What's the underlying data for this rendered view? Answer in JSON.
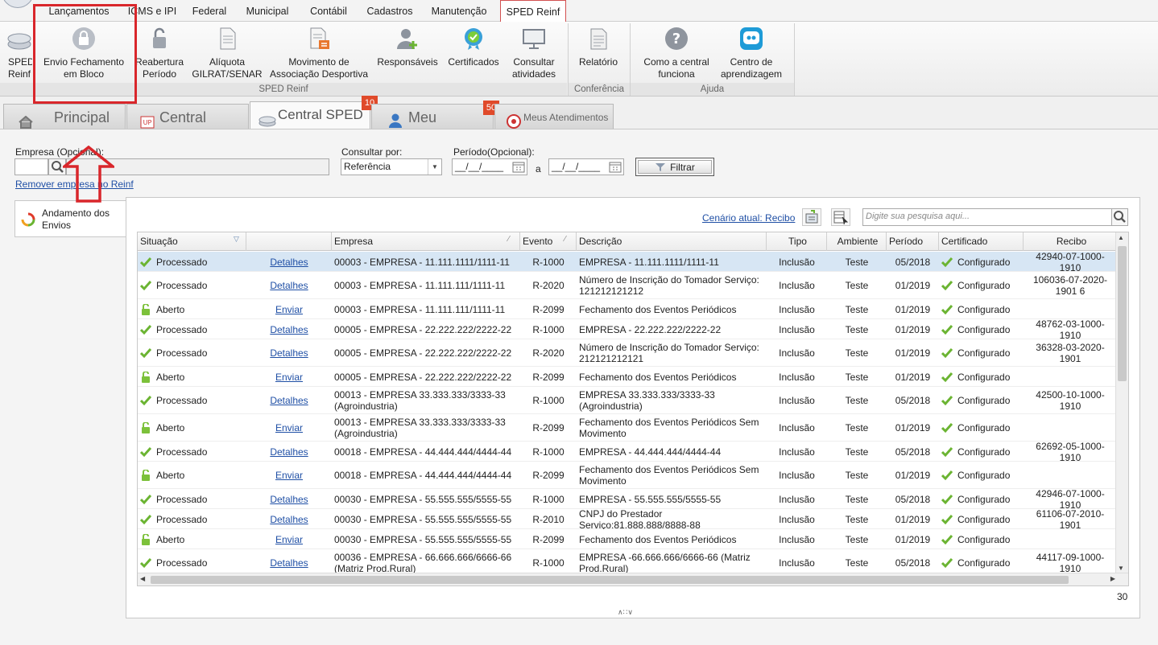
{
  "menu": {
    "tabs": [
      {
        "label": "Lançamentos"
      },
      {
        "label": "ICMS e IPI"
      },
      {
        "label": "Federal"
      },
      {
        "label": "Municipal"
      },
      {
        "label": "Contábil"
      },
      {
        "label": "Cadastros"
      },
      {
        "label": "Manutenção"
      },
      {
        "label": "SPED Reinf",
        "active": true
      }
    ]
  },
  "ribbon": {
    "buttons": [
      {
        "label": "SPED Reinf",
        "icon": "sped-icon"
      },
      {
        "label": "Envio Fechamento em Bloco",
        "icon": "lock-icon"
      },
      {
        "label": "Reabertura Período",
        "icon": "unlock-icon"
      },
      {
        "label": "Alíquota GILRAT/SENAR",
        "icon": "document-icon"
      },
      {
        "label": "Movimento de Associação Desportiva",
        "icon": "document-arrows-icon"
      },
      {
        "label": "Responsáveis",
        "icon": "user-add-icon"
      },
      {
        "label": "Certificados",
        "icon": "certificate-icon"
      },
      {
        "label": "Consultar atividades",
        "icon": "monitor-icon"
      },
      {
        "label": "Relatório",
        "icon": "report-icon"
      },
      {
        "label": "Como a central funciona",
        "icon": "help-icon"
      },
      {
        "label": "Centro de aprendizagem",
        "icon": "learning-icon"
      }
    ],
    "groups": [
      "SPED Reinf",
      "Conferência",
      "Ajuda"
    ]
  },
  "tabs": [
    {
      "label": "Principal",
      "icon": "home-icon"
    },
    {
      "label": "Central PackUp",
      "icon": "packup-icon"
    },
    {
      "label": "Central SPED Reinf",
      "icon": "sped-icon",
      "badge": "10",
      "active": true
    },
    {
      "label": "Meu Gerente",
      "icon": "user-icon",
      "badge": "50"
    },
    {
      "label": "Meus Atendimentos",
      "icon": "support-icon"
    }
  ],
  "filters": {
    "empresa_label": "Empresa (Opcional):",
    "empresa_value": "",
    "remover_link": "Remover empresa no Reinf",
    "consultar_label": "Consultar por:",
    "consultar_value": "Referência",
    "periodo_label": "Período(Opcional):",
    "periodo_from": "__/__/____",
    "periodo_sep": "a",
    "periodo_to": "__/__/____",
    "filtrar_label": "Filtrar"
  },
  "sidebar": {
    "item_label": "Andamento dos Envios"
  },
  "toolbar": {
    "cenario_link": "Cenário atual: Recibo",
    "search_placeholder": "Digite sua pesquisa aqui..."
  },
  "grid": {
    "headers": [
      "Situação",
      "",
      "Empresa",
      "Evento",
      "Descrição",
      "Tipo",
      "Ambiente",
      "Período",
      "Certificado",
      "Recibo"
    ],
    "rows": [
      {
        "situacao": "Processado",
        "status": "ok",
        "acao": "Detalhes",
        "empresa": "00003 - EMPRESA - 11.111.1111/1111-11",
        "evento": "R-1000",
        "descricao": "EMPRESA - 11.111.1111/1111-11",
        "tipo": "Inclusão",
        "ambiente": "Teste",
        "periodo": "05/2018",
        "certificado": "Configurado",
        "recibo": "42940-07-1000-1910",
        "h": 25,
        "selected": true
      },
      {
        "situacao": "Processado",
        "status": "ok",
        "acao": "Detalhes",
        "empresa": "00003 - EMPRESA - 11.111.111/1111-11",
        "evento": "R-2020",
        "descricao": "Número de Inscrição do Tomador Serviço: 121212121212",
        "tipo": "Inclusão",
        "ambiente": "Teste",
        "periodo": "01/2019",
        "certificado": "Configurado",
        "recibo": "106036-07-2020-1901 6",
        "h": 34
      },
      {
        "situacao": "Aberto",
        "status": "open",
        "acao": "Enviar",
        "empresa": "00003 - EMPRESA -  11.111.111/1111-11",
        "evento": "R-2099",
        "descricao": "Fechamento dos Eventos Periódicos",
        "tipo": "Inclusão",
        "ambiente": "Teste",
        "periodo": "01/2019",
        "certificado": "Configurado",
        "recibo": "",
        "h": 25
      },
      {
        "situacao": "Processado",
        "status": "ok",
        "acao": "Detalhes",
        "empresa": "00005 - EMPRESA -  22.222.222/2222-22",
        "evento": "R-1000",
        "descricao": "EMPRESA -  22.222.222/2222-22",
        "tipo": "Inclusão",
        "ambiente": "Teste",
        "periodo": "01/2019",
        "certificado": "Configurado",
        "recibo": "48762-03-1000-1910",
        "h": 25
      },
      {
        "situacao": "Processado",
        "status": "ok",
        "acao": "Detalhes",
        "empresa": "00005 - EMPRESA -  22.222.222/2222-22",
        "evento": "R-2020",
        "descricao": "Número de Inscrição do Tomador Serviço: 212121212121",
        "tipo": "Inclusão",
        "ambiente": "Teste",
        "periodo": "01/2019",
        "certificado": "Configurado",
        "recibo": "36328-03-2020-1901",
        "h": 34
      },
      {
        "situacao": "Aberto",
        "status": "open",
        "acao": "Enviar",
        "empresa": "00005 - EMPRESA -  22.222.222/2222-22",
        "evento": "R-2099",
        "descricao": "Fechamento dos Eventos Periódicos",
        "tipo": "Inclusão",
        "ambiente": "Teste",
        "periodo": "01/2019",
        "certificado": "Configurado",
        "recibo": "",
        "h": 25
      },
      {
        "situacao": "Processado",
        "status": "ok",
        "acao": "Detalhes",
        "empresa": "00013 - EMPRESA   33.333.333/3333-33 (Agroindustria)",
        "evento": "R-1000",
        "descricao": "EMPRESA   33.333.333/3333-33 (Agroindustria)",
        "tipo": "Inclusão",
        "ambiente": "Teste",
        "periodo": "05/2018",
        "certificado": "Configurado",
        "recibo": "42500-10-1000-1910",
        "h": 34
      },
      {
        "situacao": "Aberto",
        "status": "open",
        "acao": "Enviar",
        "empresa": "00013 - EMPRESA   33.333.333/3333-33 (Agroindustria)",
        "evento": "R-2099",
        "descricao": "Fechamento dos Eventos Periódicos Sem Movimento",
        "tipo": "Inclusão",
        "ambiente": "Teste",
        "periodo": "01/2019",
        "certificado": "Configurado",
        "recibo": "",
        "h": 34
      },
      {
        "situacao": "Processado",
        "status": "ok",
        "acao": "Detalhes",
        "empresa": "00018 - EMPRESA - 44.444.444/4444-44",
        "evento": "R-1000",
        "descricao": "EMPRESA -   44.444.444/4444-44",
        "tipo": "Inclusão",
        "ambiente": "Teste",
        "periodo": "05/2018",
        "certificado": "Configurado",
        "recibo": "62692-05-1000-1910",
        "h": 25
      },
      {
        "situacao": "Aberto",
        "status": "open",
        "acao": "Enviar",
        "empresa": "00018 - EMPRESA - 44.444.444/4444-44",
        "evento": "R-2099",
        "descricao": "Fechamento dos Eventos Periódicos Sem Movimento",
        "tipo": "Inclusão",
        "ambiente": "Teste",
        "periodo": "01/2019",
        "certificado": "Configurado",
        "recibo": "",
        "h": 34
      },
      {
        "situacao": "Processado",
        "status": "ok",
        "acao": "Detalhes",
        "empresa": "00030 - EMPRESA - 55.555.555/5555-55",
        "evento": "R-1000",
        "descricao": "EMPRESA -   55.555.555/5555-55",
        "tipo": "Inclusão",
        "ambiente": "Teste",
        "periodo": "05/2018",
        "certificado": "Configurado",
        "recibo": "42946-07-1000-1910",
        "h": 25
      },
      {
        "situacao": "Processado",
        "status": "ok",
        "acao": "Detalhes",
        "empresa": "00030 - EMPRESA - 55.555.555/5555-55",
        "evento": "R-2010",
        "descricao": "CNPJ do Prestador Serviço:81.888.888/8888-88",
        "tipo": "Inclusão",
        "ambiente": "Teste",
        "periodo": "01/2019",
        "certificado": "Configurado",
        "recibo": "61106-07-2010-1901",
        "h": 25
      },
      {
        "situacao": "Aberto",
        "status": "open",
        "acao": "Enviar",
        "empresa": "00030 - EMPRESA -  55.555.555/5555-55",
        "evento": "R-2099",
        "descricao": "Fechamento dos Eventos Periódicos",
        "tipo": "Inclusão",
        "ambiente": "Teste",
        "periodo": "01/2019",
        "certificado": "Configurado",
        "recibo": "",
        "h": 25
      },
      {
        "situacao": "Processado",
        "status": "ok",
        "acao": "Detalhes",
        "empresa": "00036 - EMPRESA - 66.666.666/6666-66 (Matriz Prod.Rural)",
        "evento": "R-1000",
        "descricao": "EMPRESA -66.666.666/6666-66 (Matriz Prod.Rural)",
        "tipo": "Inclusão",
        "ambiente": "Teste",
        "periodo": "05/2018",
        "certificado": "Configurado",
        "recibo": "44117-09-1000-1910",
        "h": 34
      }
    ],
    "total": "30"
  },
  "colors": {
    "accent": "#d9262b",
    "link": "#1f4fa5",
    "check": "#6bb432",
    "badge": "#e04a2a"
  }
}
